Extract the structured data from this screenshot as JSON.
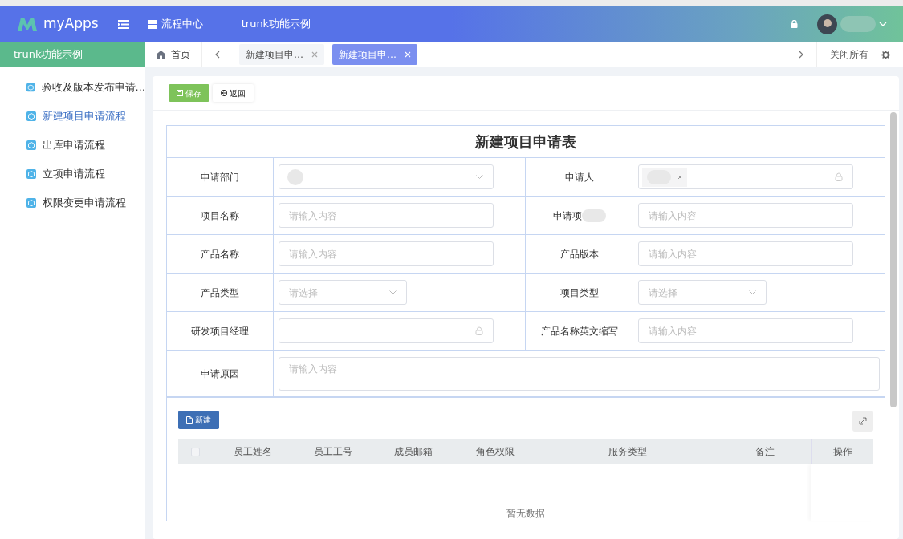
{
  "header": {
    "logo_text": "myApps",
    "nav": [
      {
        "kind": "grid",
        "label": "流程中心"
      },
      {
        "kind": "plain",
        "label": "trunk功能示例"
      }
    ]
  },
  "sidebar": {
    "title": "trunk功能示例",
    "items": [
      {
        "label": "验收及版本发布申请…",
        "selected": false
      },
      {
        "label": "新建项目申请流程",
        "selected": true
      },
      {
        "label": "出库申请流程",
        "selected": false
      },
      {
        "label": "立项申请流程",
        "selected": false
      },
      {
        "label": "权限变更申请流程",
        "selected": false
      }
    ]
  },
  "tabs": {
    "home": "首页",
    "items": [
      {
        "label": "新建项目申…",
        "selected": false
      },
      {
        "label": "新建项目申…",
        "selected": true
      }
    ],
    "close_all": "关闭所有"
  },
  "toolbar": [
    {
      "kind": "save",
      "label": "保存"
    },
    {
      "kind": "back",
      "label": "返回"
    }
  ],
  "form": {
    "title": "新建项目申请表",
    "fields": [
      {
        "label": "申请部门",
        "kind": "picker"
      },
      {
        "label": "申请人",
        "kind": "user"
      },
      {
        "label": "项目名称",
        "kind": "input",
        "placeholder": "请输入内容"
      },
      {
        "label": "申请项",
        "kind": "input",
        "placeholder": "请输入内容"
      },
      {
        "label": "产品名称",
        "kind": "input",
        "placeholder": "请输入内容"
      },
      {
        "label": "产品版本",
        "kind": "input",
        "placeholder": "请输入内容"
      },
      {
        "label": "产品类型",
        "kind": "select",
        "placeholder": "请选择"
      },
      {
        "label": "项目类型",
        "kind": "select",
        "placeholder": "请选择"
      },
      {
        "label": "研发项目经理",
        "kind": "locked"
      },
      {
        "label": "产品名称英文缩写",
        "kind": "input",
        "placeholder": "请输入内容"
      },
      {
        "label": "申请原因",
        "kind": "textarea",
        "placeholder": "请输入内容"
      }
    ]
  },
  "table": {
    "new_button": "新建",
    "columns": [
      "员工姓名",
      "员工工号",
      "成员邮箱",
      "角色权限",
      "服务类型",
      "备注"
    ],
    "action_column": "操作",
    "select_all_checked": false,
    "empty_text": "暂无数据"
  }
}
